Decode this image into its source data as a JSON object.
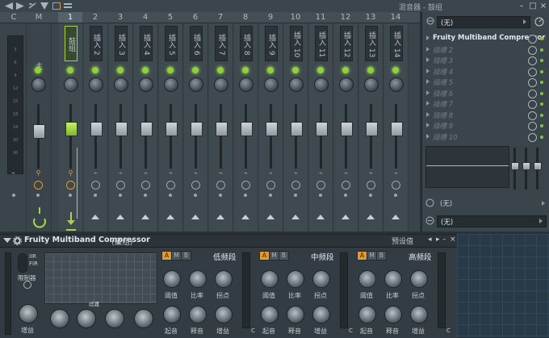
{
  "mixer": {
    "title": "混音器 - 鼓组",
    "master_label": "主",
    "header_left": [
      "C",
      "M"
    ],
    "channels": [
      {
        "num": "1",
        "name": "鼓组",
        "selected": true
      },
      {
        "num": "2",
        "name": "插入 2"
      },
      {
        "num": "3",
        "name": "插入 3"
      },
      {
        "num": "4",
        "name": "插入 4"
      },
      {
        "num": "5",
        "name": "插入 5"
      },
      {
        "num": "6",
        "name": "插入 6"
      },
      {
        "num": "7",
        "name": "插入 7"
      },
      {
        "num": "8",
        "name": "插入 8"
      },
      {
        "num": "9",
        "name": "插入 9"
      },
      {
        "num": "10",
        "name": "插入 10"
      },
      {
        "num": "11",
        "name": "插入 11"
      },
      {
        "num": "12",
        "name": "插入 12"
      },
      {
        "num": "13",
        "name": "插入 13"
      },
      {
        "num": "14",
        "name": "插入 14"
      }
    ],
    "meter_ticks": [
      "3",
      "6",
      "9",
      "12",
      "15",
      "18",
      "24",
      "30",
      "36"
    ]
  },
  "side": {
    "input_dropdown": "(无)",
    "slots": [
      "Fruity Multiband Compressor",
      "插槽 2",
      "插槽 3",
      "插槽 4",
      "插槽 5",
      "插槽 6",
      "插槽 7",
      "插槽 8",
      "插槽 9",
      "插槽 10"
    ],
    "bottom_label": "(无)",
    "output_dropdown": "(无)"
  },
  "plugin": {
    "name": "Fruity Multiband Compressor",
    "target": "(鼓组)",
    "preset_label": "预设值",
    "iir": "IIR",
    "fir": "FIR",
    "limiter_label": "限制器",
    "output_label": "增益",
    "bands": [
      {
        "name": "低频段",
        "knobs_top": [
          "阈值",
          "比率",
          "拐点"
        ],
        "knobs_bottom": [
          "起音",
          "释音",
          "增益"
        ]
      },
      {
        "name": "中频段",
        "knobs_top": [
          "阈值",
          "比率",
          "拐点"
        ],
        "knobs_bottom": [
          "起音",
          "释音",
          "增益"
        ]
      },
      {
        "name": "高频段",
        "knobs_top": [
          "阈值",
          "比率",
          "拐点"
        ],
        "knobs_bottom": [
          "起音",
          "释音",
          "增益"
        ]
      }
    ],
    "amb_buttons": [
      "A",
      "M",
      "B"
    ],
    "band_c": "C",
    "graph_label": "过渡"
  },
  "colors": {
    "accent": "#8ed13a",
    "band_button": "#e39a2a"
  }
}
